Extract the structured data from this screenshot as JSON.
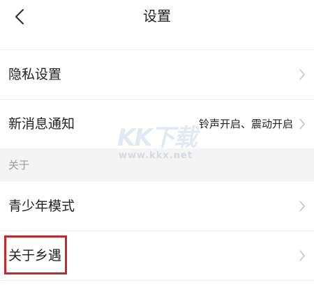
{
  "nav": {
    "title": "设置",
    "back_icon": "chevron-left-icon"
  },
  "settings": {
    "privacy": {
      "label": "隐私设置",
      "icon": "chevron-right-icon"
    },
    "notifications": {
      "label": "新消息通知",
      "value": "铃声开启、震动开启",
      "icon": "chevron-right-icon"
    }
  },
  "about_section": {
    "header": "关于",
    "youth_mode": {
      "label": "青少年模式",
      "icon": "chevron-right-icon"
    },
    "about_app": {
      "label": "关于乡遇",
      "icon": "chevron-right-icon"
    }
  },
  "watermark": {
    "logo_text": "KK下载",
    "url_text": "www.kkx.net"
  },
  "colors": {
    "highlight": "#c8262b",
    "section_bg": "#f4f4f4",
    "chevron": "#c4c4c4",
    "text": "#222222",
    "muted": "#9a9a9a"
  }
}
